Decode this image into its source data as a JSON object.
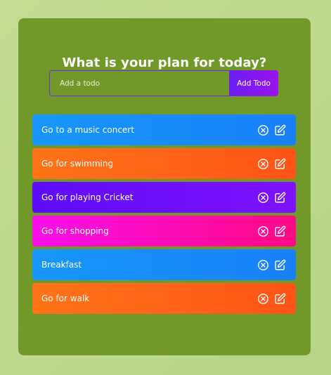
{
  "header": {
    "title": "What is your plan for today?"
  },
  "form": {
    "placeholder": "Add a todo",
    "value": "",
    "button_label": "Add Todo"
  },
  "todos": [
    {
      "text": "Go to a music concert",
      "color_start": "#1697fd",
      "color_end": "#1a80f8"
    },
    {
      "text": "Go for swimming",
      "color_start": "#ff7417",
      "color_end": "#ff5418"
    },
    {
      "text": "Go for playing Cricket",
      "color_start": "#5d0cf8",
      "color_end": "#7f12fd"
    },
    {
      "text": "Go for shopping",
      "color_start": "#f90eeb",
      "color_end": "#ff0a84"
    },
    {
      "text": "Breakfast",
      "color_start": "#1697fd",
      "color_end": "#1a80f8"
    },
    {
      "text": "Go for walk",
      "color_start": "#ff7417",
      "color_end": "#ff5418"
    }
  ],
  "icons": {
    "delete": "close-circle-icon",
    "edit": "edit-icon"
  }
}
